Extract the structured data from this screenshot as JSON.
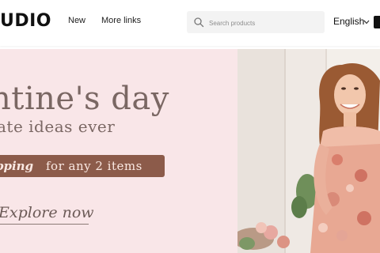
{
  "header": {
    "brand": "UDIO",
    "nav": [
      {
        "label": "New"
      },
      {
        "label": "More links"
      }
    ],
    "search": {
      "placeholder": "Search products"
    },
    "language": "English"
  },
  "banner": {
    "headline": "ntine's day",
    "subline": "ate ideas ever",
    "promo_bold": "pping",
    "promo_rest": "for any 2 items",
    "cta": "Explore now"
  },
  "colors": {
    "banner_bg": "#f9e6e8",
    "headline": "#7a6763",
    "promo_bg": "#8c5b4a",
    "promo_text": "#fbe9e3"
  },
  "icons": {
    "search": "search-icon",
    "language_chevron": "chevron-down-icon"
  }
}
